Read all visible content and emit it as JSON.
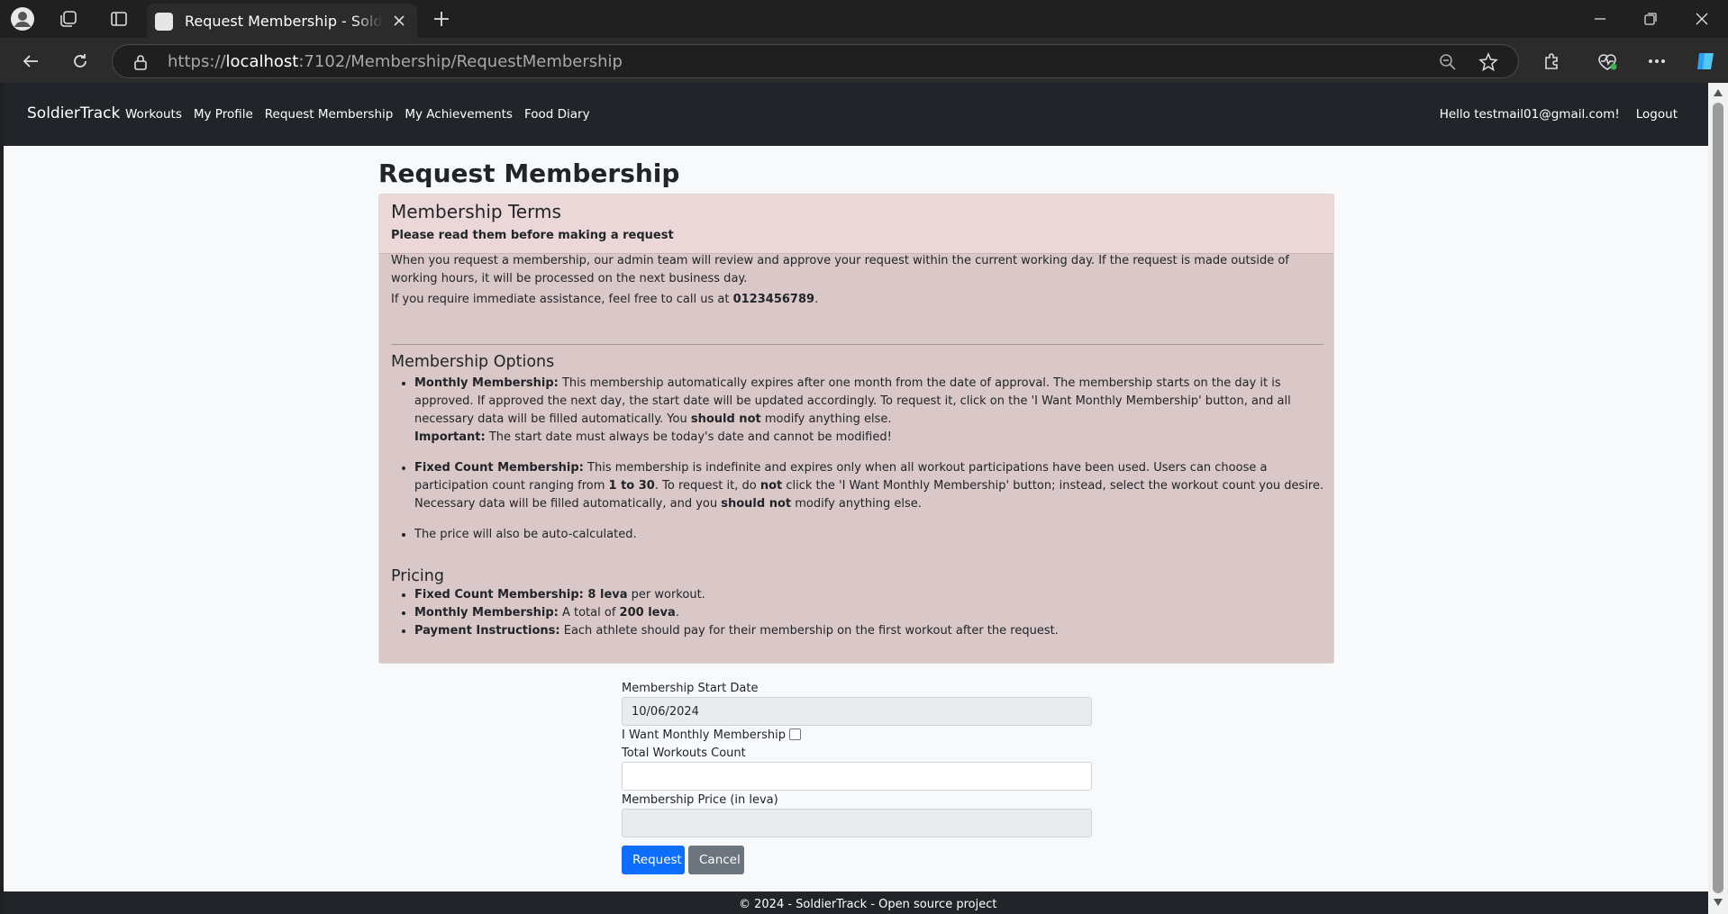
{
  "browser": {
    "tab_title": "Request Membership - SoldierTrack",
    "url_prefix": "https://",
    "url_host": "localhost",
    "url_rest": ":7102/Membership/RequestMembership"
  },
  "navbar": {
    "brand": "SoldierTrack",
    "links": [
      "Workouts",
      "My Profile",
      "Request Membership",
      "My Achievements",
      "Food Diary"
    ],
    "greeting": "Hello testmail01@gmail.com!",
    "logout": "Logout"
  },
  "page": {
    "title": "Request Membership"
  },
  "terms": {
    "header": "Membership Terms",
    "subheader": "Please read them before making a request",
    "intro": "When you request a membership, our admin team will review and approve your request within the current working day. If the request is made outside of working hours, it will be processed on the next business day.",
    "assist_prefix": "If you require immediate assistance, feel free to call us at ",
    "phone": "0123456789",
    "assist_suffix": ".",
    "options_title": "Membership Options",
    "monthly_label": "Monthly Membership:",
    "monthly_text1": " This membership automatically expires after one month from the date of approval. The membership starts on the day it is approved. If approved the next day, the start date will be updated accordingly. To request it, click on the 'I Want Monthly Membership' button, and all necessary data will be filled automatically. You ",
    "monthly_bold": "should not",
    "monthly_text2": " modify anything else.",
    "important_label": "Important:",
    "important_text": " The start date must always be today's date and cannot be modified!",
    "fixed_label": "Fixed Count Membership:",
    "fixed_text1": " This membership is indefinite and expires only when all workout participations have been used. Users can choose a participation count ranging from ",
    "fixed_range": "1 to 30",
    "fixed_text2": ". To request it, do ",
    "fixed_not": "not",
    "fixed_text3": " click the 'I Want Monthly Membership' button; instead, select the workout count you desire. Necessary data will be filled automatically, and you ",
    "fixed_bold": "should not",
    "fixed_text4": " modify anything else.",
    "price_note": "The price will also be auto-calculated.",
    "pricing_title": "Pricing",
    "p1_label": "Fixed Count Membership:",
    "p1_value": " 8 leva",
    "p1_text": " per workout.",
    "p2_label": "Monthly Membership:",
    "p2_text": " A total of ",
    "p2_value": "200 leva",
    "p2_end": ".",
    "p3_label": "Payment Instructions:",
    "p3_text": " Each athlete should pay for their membership on the first workout after the request."
  },
  "form": {
    "start_date_label": "Membership Start Date",
    "start_date_value": "10/06/2024",
    "monthly_checkbox_label": "I Want Monthly Membership",
    "workouts_label": "Total Workouts Count",
    "workouts_value": "",
    "price_label": "Membership Price (in leva)",
    "price_value": "",
    "request_button": "Request",
    "cancel_button": "Cancel"
  },
  "footer": {
    "text": "© 2024 - SoldierTrack - Open source project"
  }
}
